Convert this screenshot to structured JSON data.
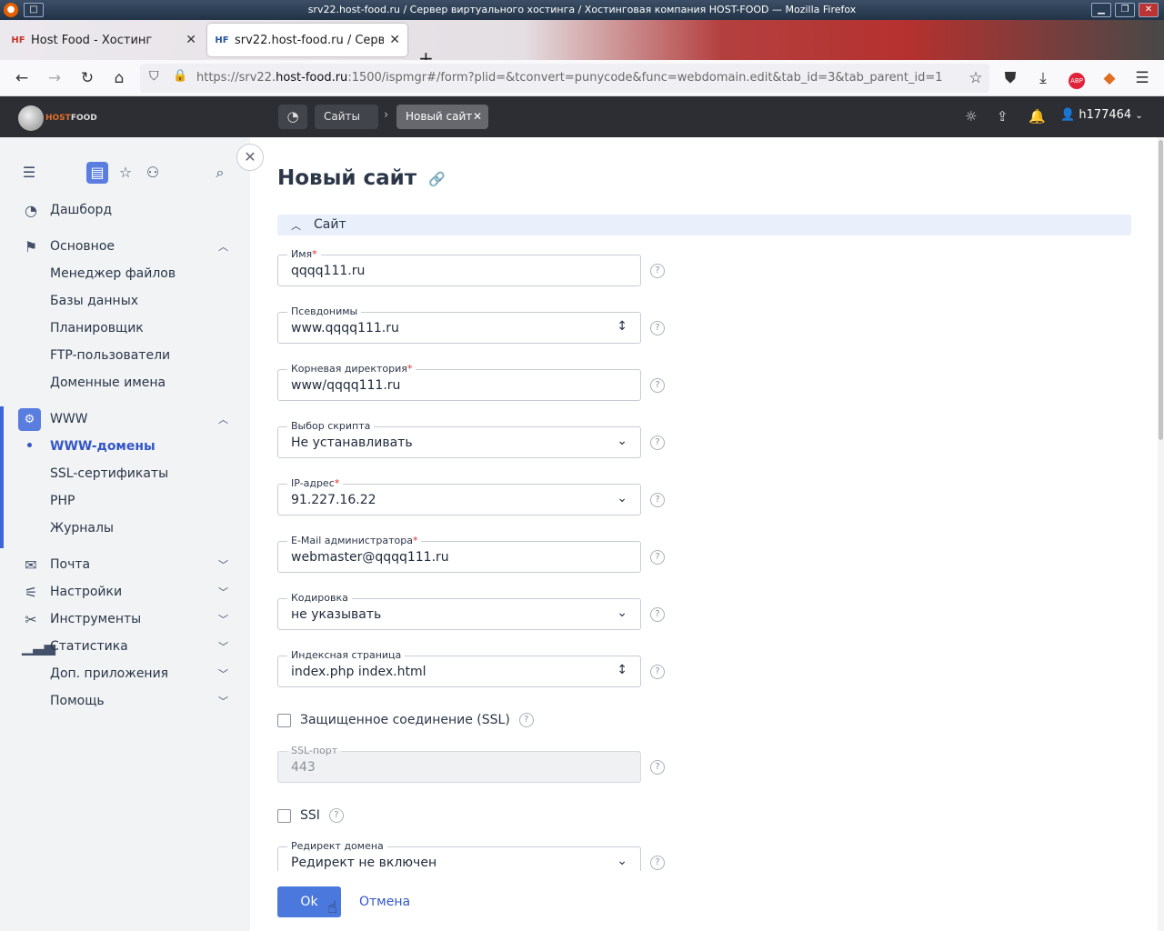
{
  "window": {
    "title": "srv22.host-food.ru / Сервер виртуального хостинга / Хостинговая компания HOST-FOOD — Mozilla Firefox"
  },
  "tabs": [
    {
      "label": "Host Food - Хостинг",
      "favicon": "HF"
    },
    {
      "label": "srv22.host-food.ru / Сервер",
      "favicon": "HF"
    }
  ],
  "url": {
    "prefix": "https://srv22.",
    "domain": "host-food.ru",
    "rest": ":1500/ispmgr#/form?plid=&tconvert=punycode&func=webdomain.edit&tab_id=3&tab_parent_id=1"
  },
  "header": {
    "logo": {
      "part1": "HOST",
      "part2": "FOOD"
    },
    "breadcrumb": [
      "Сайты",
      "Новый сайт"
    ],
    "user": "h177464"
  },
  "sidebar": {
    "groups": {
      "dashboard": "Дашборд",
      "main": "Основное",
      "www": "WWW",
      "mail": "Почта",
      "settings": "Настройки",
      "tools": "Инструменты",
      "stats": "Статистика",
      "apps": "Доп. приложения",
      "help": "Помощь"
    },
    "main_items": [
      "Менеджер файлов",
      "Базы данных",
      "Планировщик",
      "FTP-пользователи",
      "Доменные имена"
    ],
    "www_items": [
      "WWW-домены",
      "SSL-сертификаты",
      "PHP",
      "Журналы"
    ]
  },
  "page": {
    "title": "Новый сайт",
    "section": "Сайт",
    "fields": [
      {
        "label": "Имя",
        "required": "*",
        "value": "qqqq111.ru"
      },
      {
        "label": "Псевдонимы",
        "required": "",
        "value": "www.qqqq111.ru"
      },
      {
        "label": "Корневая директория",
        "required": "*",
        "value": "www/qqqq111.ru"
      },
      {
        "label": "Выбор скрипта",
        "required": "",
        "value": "Не устанавливать"
      },
      {
        "label": "IP-адрес",
        "required": "*",
        "value": "91.227.16.22"
      },
      {
        "label": "E-Mail администратора",
        "required": "*",
        "value": "webmaster@qqqq111.ru"
      },
      {
        "label": "Кодировка",
        "required": "",
        "value": "не указывать"
      },
      {
        "label": "Индексная страница",
        "required": "",
        "value": "index.php index.html"
      },
      {
        "label": "SSL-порт",
        "required": "",
        "value": "443"
      },
      {
        "label": "Редирект домена",
        "required": "",
        "value": "Редирект не включен"
      }
    ],
    "checkboxes": {
      "ssl": "Защищенное соединение (SSL)",
      "ssi": "SSI"
    },
    "help_glyph": "?",
    "ok": "Ok",
    "cancel": "Отмена"
  }
}
